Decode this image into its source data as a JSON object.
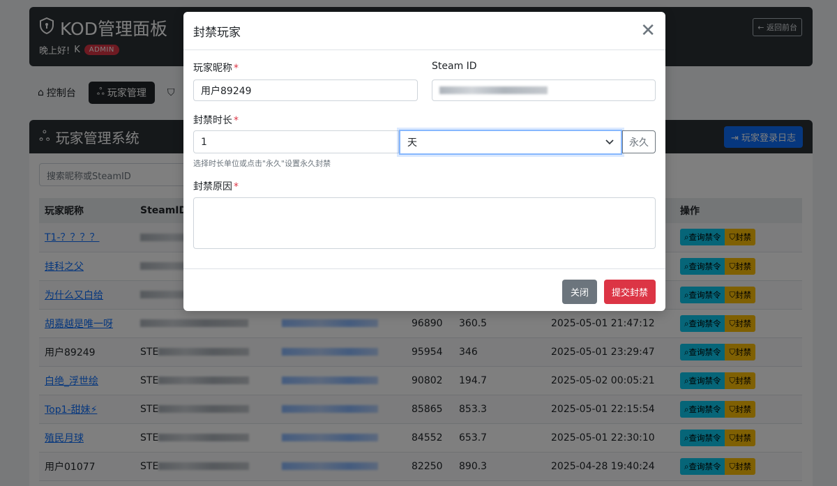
{
  "header": {
    "title": "KOD管理面板",
    "greeting": "晚上好!",
    "user": "K",
    "role_badge": "ADMIN",
    "back_button": "返回前台"
  },
  "nav": {
    "items": [
      {
        "label": "控制台",
        "icon": "home-icon"
      },
      {
        "label": "玩家管理",
        "icon": "users-icon",
        "active": true
      },
      {
        "label": "",
        "icon": "shield-icon"
      }
    ]
  },
  "panel": {
    "title": "玩家管理系统",
    "log_button": "玩家登录日志",
    "search_placeholder": "搜索昵称或SteamID",
    "columns": [
      "玩家昵称",
      "SteamID",
      "",
      "",
      "",
      "",
      "操作"
    ],
    "rows": [
      {
        "nickname": "T1-？？？？",
        "link": true,
        "steam_prefix": "",
        "num": "",
        "value": "",
        "time": ""
      },
      {
        "nickname": "挂科之父",
        "link": true,
        "steam_prefix": "",
        "num": "",
        "value": "",
        "time": ""
      },
      {
        "nickname": "为什么又白给",
        "link": true,
        "steam_prefix": "",
        "num": "",
        "value": "",
        "time": ""
      },
      {
        "nickname": "胡嘉越是唯一呀",
        "link": true,
        "steam_prefix": "",
        "num": "96890",
        "value": "360.5",
        "time": "2025-05-01 21:47:12"
      },
      {
        "nickname": "用户89249",
        "link": false,
        "steam_prefix": "STE",
        "num": "95954",
        "value": "346",
        "time": "2025-05-01 23:29:47"
      },
      {
        "nickname": "白绝_浮世绘",
        "link": true,
        "steam_prefix": "STE",
        "num": "90802",
        "value": "194.7",
        "time": "2025-05-02 00:05:21"
      },
      {
        "nickname": "Top1-甜妹⚡",
        "link": true,
        "steam_prefix": "STE",
        "num": "85865",
        "value": "853.3",
        "time": "2025-05-01 22:15:54"
      },
      {
        "nickname": "殖民月球",
        "link": true,
        "steam_prefix": "STE",
        "num": "84552",
        "value": "653.7",
        "time": "2025-05-01 22:30:10"
      },
      {
        "nickname": "用户01077",
        "link": false,
        "steam_prefix": "STE",
        "num": "82250",
        "value": "890.3",
        "time": "2025-04-28 19:40:24"
      }
    ],
    "query_button": "查询禁令",
    "ban_button": "封禁"
  },
  "modal": {
    "title": "封禁玩家",
    "nickname_label": "玩家昵称",
    "nickname_value": "用户89249",
    "steam_label": "Steam ID",
    "duration_label": "封禁时长",
    "duration_value": "1",
    "unit_value": "天",
    "permanent_button": "永久",
    "hint": "选择时长单位或点击\"永久\"设置永久封禁",
    "reason_label": "封禁原因",
    "reason_value": "",
    "close_button": "关闭",
    "submit_button": "提交封禁",
    "required_mark": "*"
  },
  "colors": {
    "dark": "#2b3035",
    "primary": "#0d6efd",
    "danger": "#dc3545",
    "info": "#0dcaf0",
    "warning": "#ffc107",
    "secondary": "#6c757d"
  }
}
